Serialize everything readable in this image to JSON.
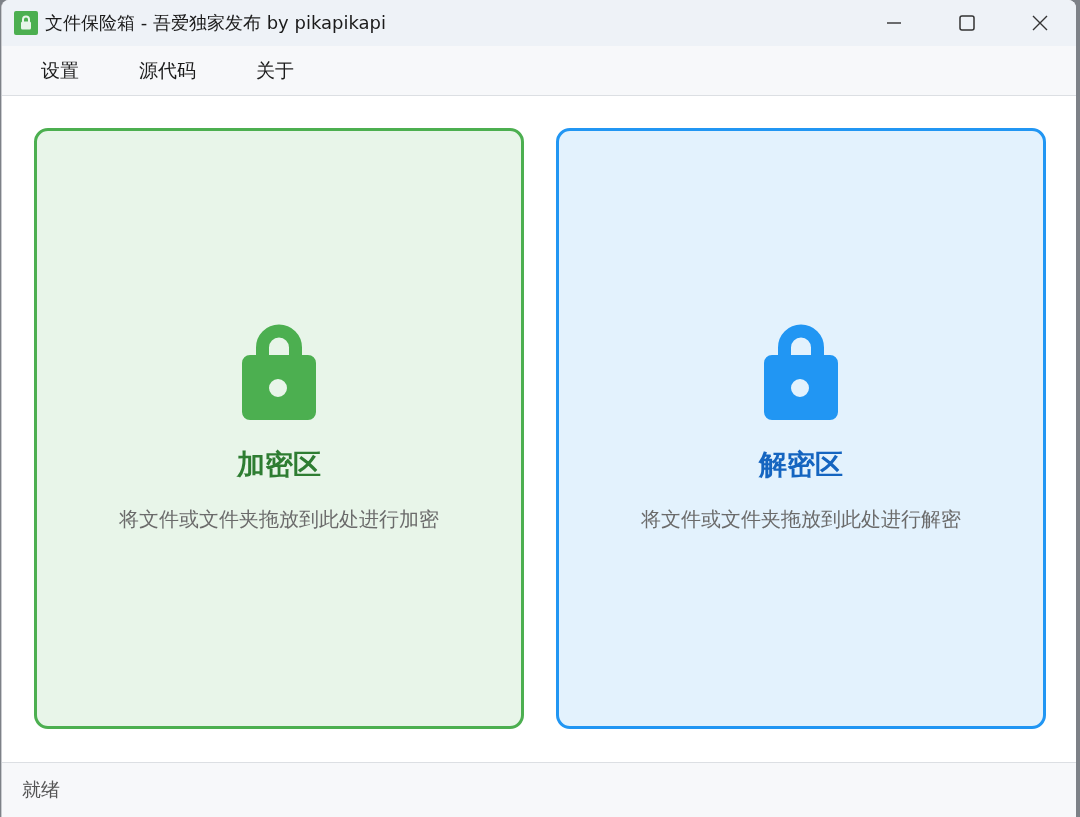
{
  "window": {
    "title": "文件保险箱 - 吾爱独家发布 by pikapikapi"
  },
  "menu": [
    {
      "label": "设置"
    },
    {
      "label": "源代码"
    },
    {
      "label": "关于"
    }
  ],
  "zones": [
    {
      "kind": "encrypt",
      "title": "加密区",
      "hint": "将文件或文件夹拖放到此处进行加密",
      "color": "#4caf50"
    },
    {
      "kind": "decrypt",
      "title": "解密区",
      "hint": "将文件或文件夹拖放到此处进行解密",
      "color": "#2196f3"
    }
  ],
  "status_bar": {
    "text": "就绪"
  }
}
